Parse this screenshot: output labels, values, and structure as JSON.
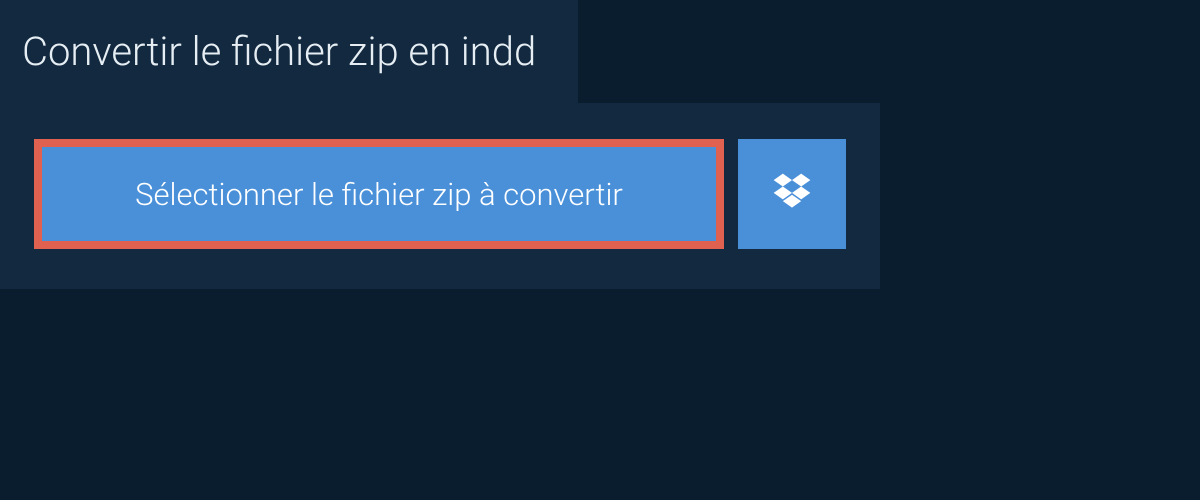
{
  "header": {
    "title": "Convertir le fichier zip en indd"
  },
  "actions": {
    "select_label": "Sélectionner le fichier zip à convertir",
    "dropbox_icon": "dropbox-icon"
  },
  "colors": {
    "page_bg": "#0a1d2f",
    "panel_bg": "#12293f",
    "button_bg": "#4a90d9",
    "highlight_border": "#e0614f"
  }
}
